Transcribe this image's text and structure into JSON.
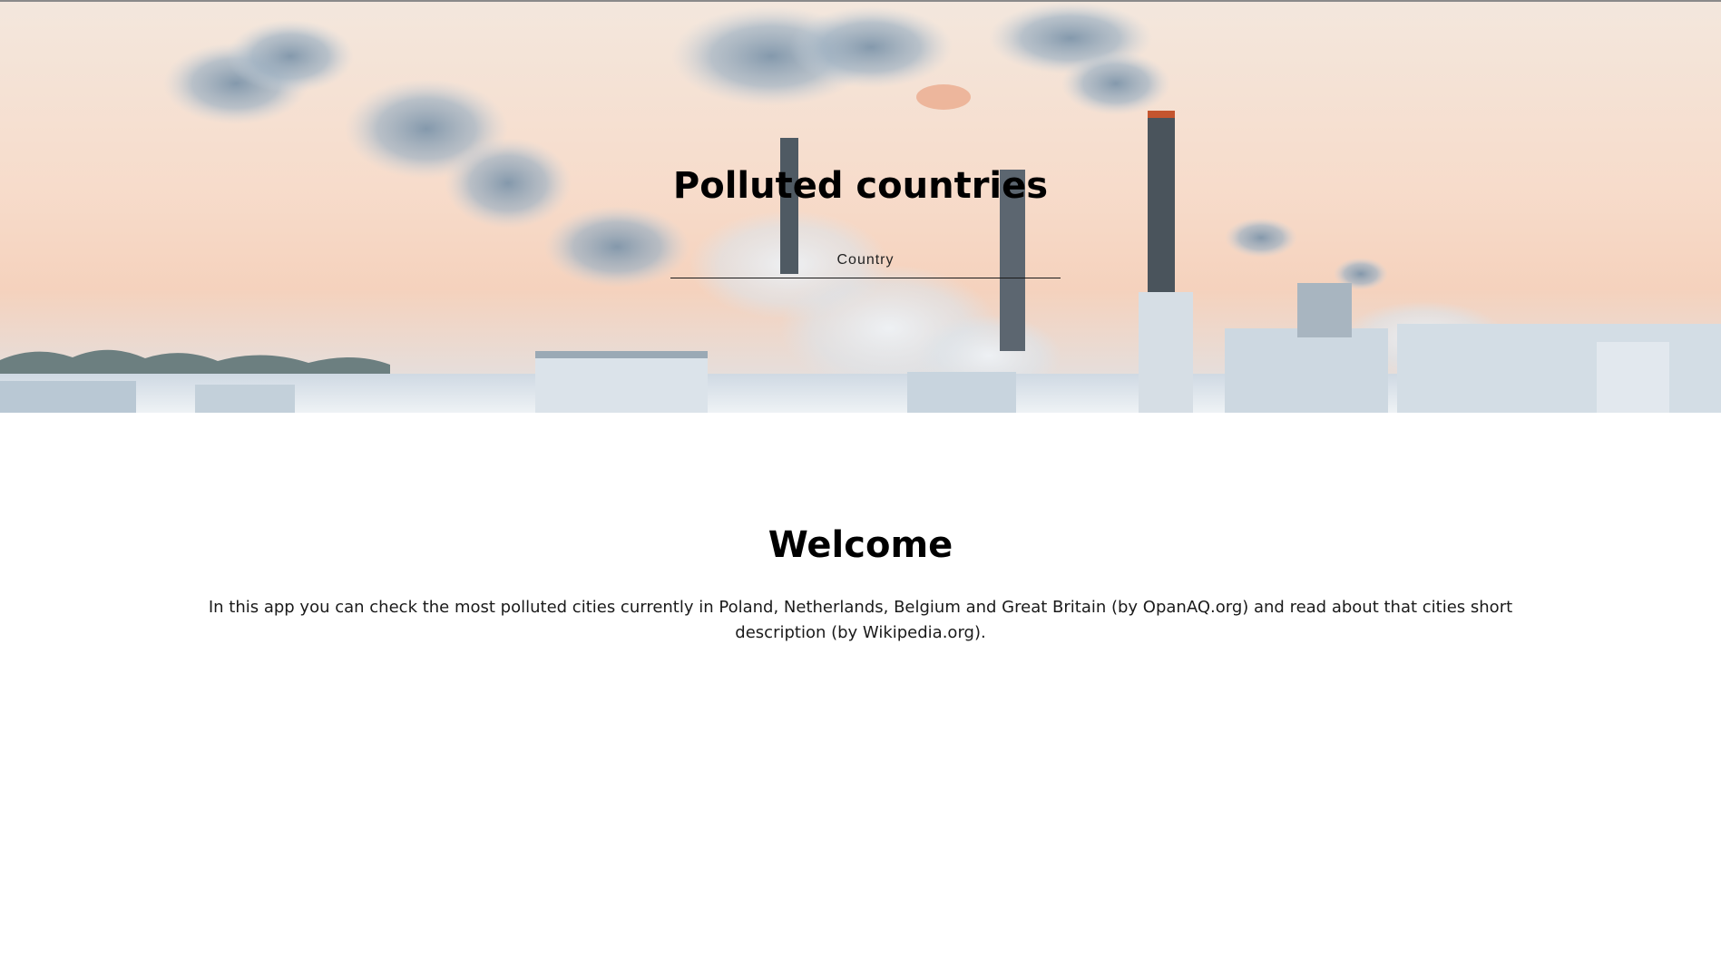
{
  "hero": {
    "title": "Polluted countries",
    "country_label": "Country"
  },
  "main": {
    "welcome_title": "Welcome",
    "intro_text": "In this app you can check the most polluted cities currently in Poland, Netherlands, Belgium and Great Britain (by OpanAQ.org) and read about that cities short description (by Wikipedia.org)."
  },
  "colors": {
    "sky_warm": "#f7dccb",
    "smoke": "#8ea2b4",
    "text": "#000000"
  }
}
